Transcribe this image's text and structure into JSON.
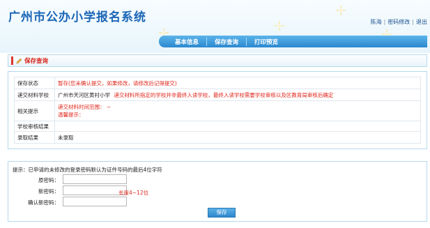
{
  "header": {
    "site_title": "广州市公办小学报名系统",
    "user_name": "陈海",
    "change_password": "密码修改",
    "logout": "退出"
  },
  "nav": {
    "tabs": [
      "基本信息",
      "保存查询",
      "打印预览"
    ]
  },
  "section": {
    "title": "保存查询"
  },
  "info_table": {
    "rows": [
      {
        "label": "保存状态",
        "value": "暂存(您未确认提交，如果修改，请修改后记得提交)"
      },
      {
        "label": "递交材料学校",
        "school": "广州市天河区黄村小学",
        "note": "递交材料所指定的学校并非最终入读学校，最终入读学校需要学校审核以及区教育局审核后确定"
      },
      {
        "label": "相关提示",
        "line1": "递交材料时间范围：  ~",
        "line2": "温馨提示："
      },
      {
        "label": "学校审核结果",
        "value": ""
      },
      {
        "label": "录取结果",
        "value": "未录取"
      }
    ]
  },
  "password_form": {
    "hint": "提示：已申请的未修改的登录密码默认为证件号码的最后4位字符",
    "old_password_label": "原密码：",
    "new_password_label": "新密码：",
    "new_password_help": "长度4~12位",
    "confirm_password_label": "确认新密码：",
    "save_label": "保存"
  },
  "colors": {
    "brand_blue": "#1b66b7",
    "nav_blue": "#2b88cf",
    "alert_red": "#e0261b"
  }
}
